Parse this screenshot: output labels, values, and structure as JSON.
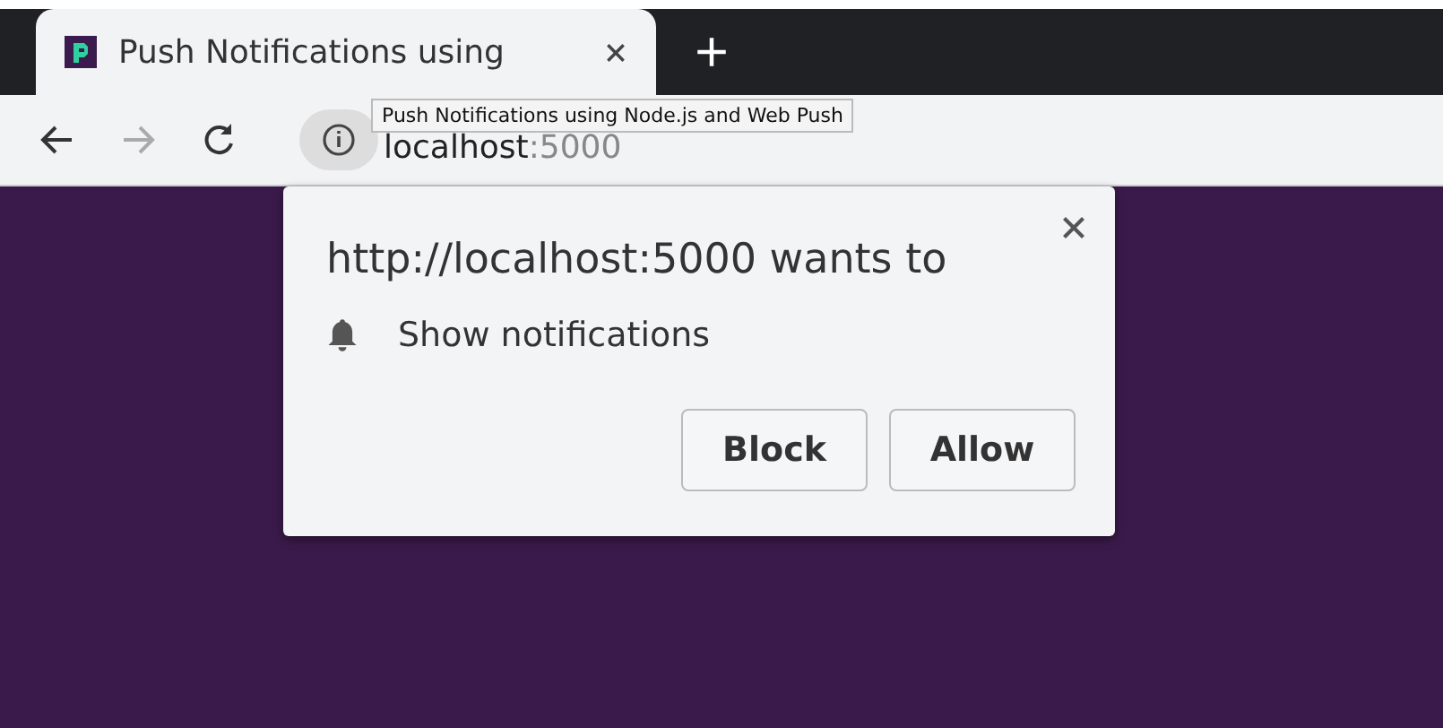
{
  "tab": {
    "title": "Push Notifications using",
    "selected": true
  },
  "toolbar": {
    "nav": [
      {
        "kind": "back",
        "disabled": false
      },
      {
        "kind": "forward",
        "disabled": true
      },
      {
        "kind": "reload",
        "disabled": false
      }
    ],
    "host": "localhost",
    "port": ":5000"
  },
  "tooltip": "Push Notifications using Node.js and Web Push",
  "prompt": {
    "title": "http://localhost:5000 wants to",
    "permission": "Show notifications",
    "buttons": [
      "Block",
      "Allow"
    ]
  }
}
